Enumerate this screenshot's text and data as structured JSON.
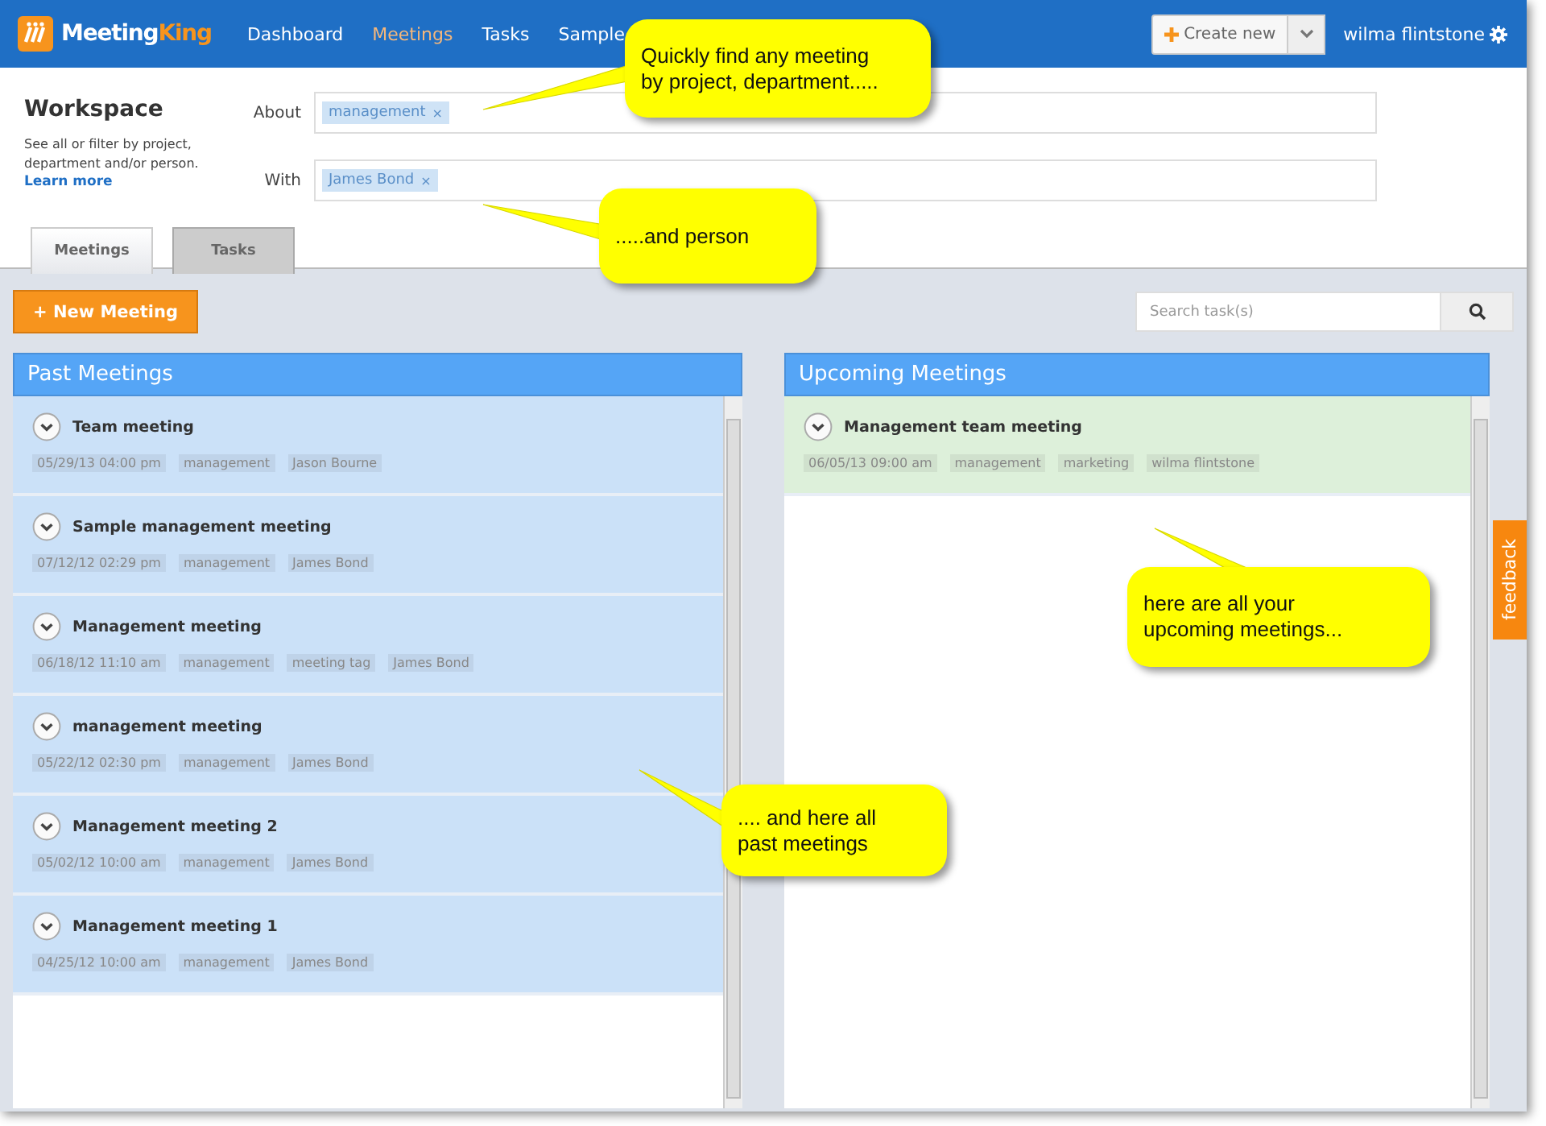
{
  "brand": {
    "name": "Meeting",
    "accent": "King"
  },
  "nav": [
    {
      "label": "Dashboard",
      "selected": false
    },
    {
      "label": "Meetings",
      "selected": true
    },
    {
      "label": "Tasks",
      "selected": false
    },
    {
      "label": "Sample",
      "selected": false
    }
  ],
  "create_button": "Create new",
  "user": "wilma flintstone",
  "workspace": {
    "title": "Workspace",
    "description": "See all or filter by project, department and/or person.",
    "link": "Learn more"
  },
  "filters": [
    {
      "label": "About",
      "tags": [
        {
          "label": "management",
          "remove": "×"
        }
      ]
    },
    {
      "label": "With",
      "tags": [
        {
          "label": "James Bond",
          "remove": "×"
        }
      ]
    }
  ],
  "tabs": [
    {
      "label": "Meetings",
      "selected": true
    },
    {
      "label": "Tasks",
      "selected": false
    }
  ],
  "new_meeting_button": "+ New Meeting",
  "search": {
    "placeholder": "Search task(s)"
  },
  "panels": [
    {
      "title": "Past Meetings",
      "kind": "past",
      "meetings": [
        {
          "title": "Team meeting",
          "tags": [
            "05/29/13 04:00 pm",
            "management",
            "Jason Bourne"
          ]
        },
        {
          "title": "Sample management meeting",
          "tags": [
            "07/12/12 02:29 pm",
            "management",
            "James Bond"
          ]
        },
        {
          "title": "Management meeting",
          "tags": [
            "06/18/12 11:10 am",
            "management",
            "meeting tag",
            "James Bond"
          ]
        },
        {
          "title": "management meeting",
          "tags": [
            "05/22/12 02:30 pm",
            "management",
            "James Bond"
          ]
        },
        {
          "title": "Management meeting 2",
          "tags": [
            "05/02/12 10:00 am",
            "management",
            "James Bond"
          ]
        },
        {
          "title": "Management meeting 1",
          "tags": [
            "04/25/12 10:00 am",
            "management",
            "James Bond"
          ]
        }
      ]
    },
    {
      "title": "Upcoming Meetings",
      "kind": "upcoming",
      "meetings": [
        {
          "title": "Management team meeting",
          "tags": [
            "06/05/13 09:00 am",
            "management",
            "marketing",
            "wilma flintstone"
          ]
        }
      ]
    }
  ],
  "feedback": "feedback",
  "callouts": [
    {
      "text": "Quickly find any meeting\nby project, department....."
    },
    {
      "text": ".....and person"
    },
    {
      "text": "here are all your\nupcoming meetings..."
    },
    {
      "text": ".... and here all\npast meetings"
    }
  ]
}
